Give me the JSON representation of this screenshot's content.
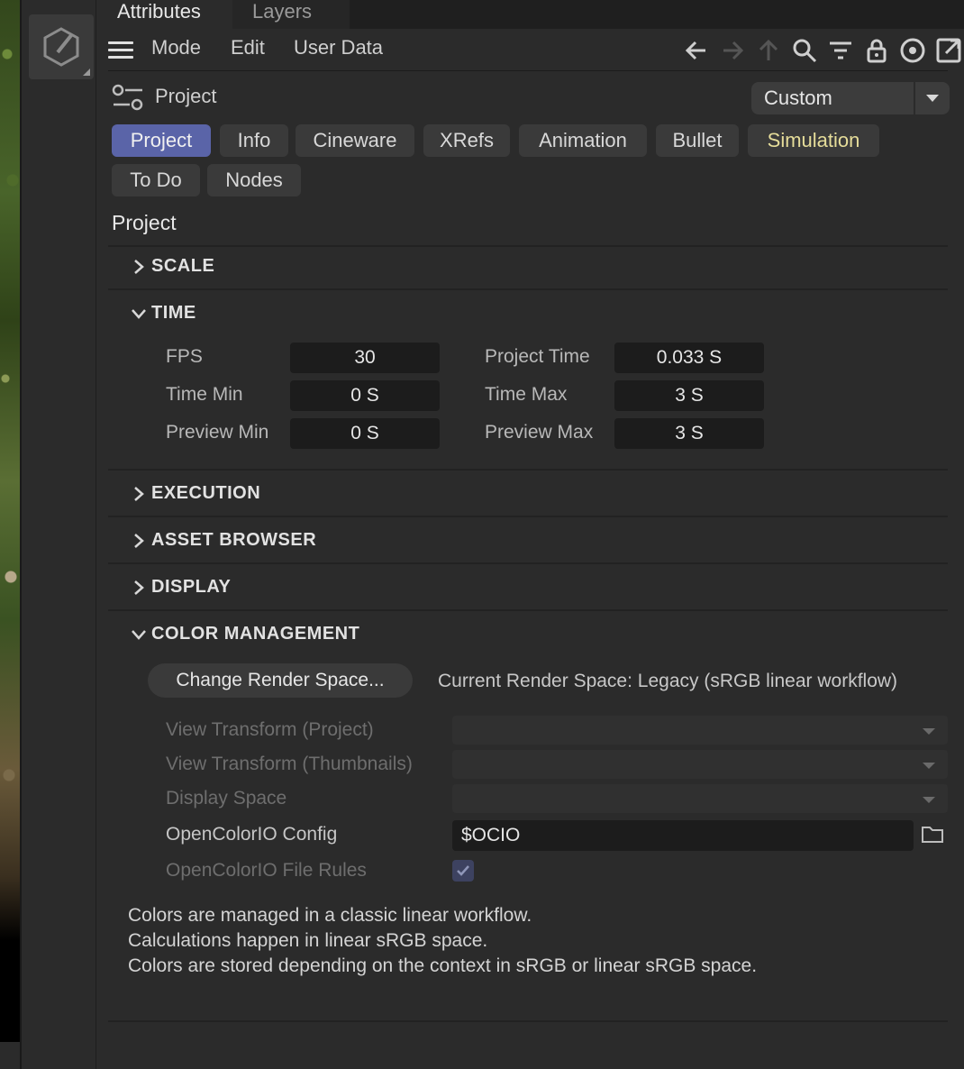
{
  "window": {
    "tabs": [
      {
        "label": "Attributes",
        "active": true
      },
      {
        "label": "Layers",
        "active": false
      }
    ]
  },
  "menubar": {
    "items": [
      "Mode",
      "Edit",
      "User Data"
    ],
    "toolbar_icons": [
      "back-arrow-icon",
      "forward-arrow-icon",
      "up-arrow-icon",
      "search-icon",
      "filter-icon",
      "lock-icon",
      "target-icon",
      "new-window-icon"
    ]
  },
  "header": {
    "object_name": "Project",
    "preset": "Custom"
  },
  "tabs": {
    "row1": [
      "Project",
      "Info",
      "Cineware",
      "XRefs",
      "Animation",
      "Bullet",
      "Simulation"
    ],
    "row2": [
      "To Do",
      "Nodes"
    ],
    "active": "Project"
  },
  "section_title": "Project",
  "groups": {
    "scale": "SCALE",
    "time": "TIME",
    "execution": "EXECUTION",
    "asset_browser": "ASSET BROWSER",
    "display": "DISPLAY",
    "color_management": "COLOR MANAGEMENT"
  },
  "time": {
    "fps_label": "FPS",
    "fps": "30",
    "project_time_label": "Project Time",
    "project_time": "0.033 S",
    "time_min_label": "Time Min",
    "time_min": "0 S",
    "time_max_label": "Time Max",
    "time_max": "3 S",
    "preview_min_label": "Preview Min",
    "preview_min": "0 S",
    "preview_max_label": "Preview Max",
    "preview_max": "3 S"
  },
  "color_management": {
    "change_button": "Change Render Space...",
    "current_render_space": "Current Render Space: Legacy (sRGB linear workflow)",
    "view_transform_project_label": "View Transform (Project)",
    "view_transform_thumbnails_label": "View Transform (Thumbnails)",
    "display_space_label": "Display Space",
    "ocio_config_label": "OpenColorIO Config",
    "ocio_config_value": "$OCIO",
    "ocio_file_rules_label": "OpenColorIO File Rules",
    "ocio_file_rules_checked": true,
    "notes": [
      "Colors are managed in a classic linear workflow.",
      "Calculations happen in linear sRGB space.",
      "Colors are stored depending on the context in sRGB or linear sRGB space."
    ]
  },
  "colors": {
    "active_tab": "#5a64a8",
    "simulation_tab_text": "#e6dd9a",
    "panel_bg": "#2b2b2b",
    "field_bg": "#1c1c1c"
  }
}
